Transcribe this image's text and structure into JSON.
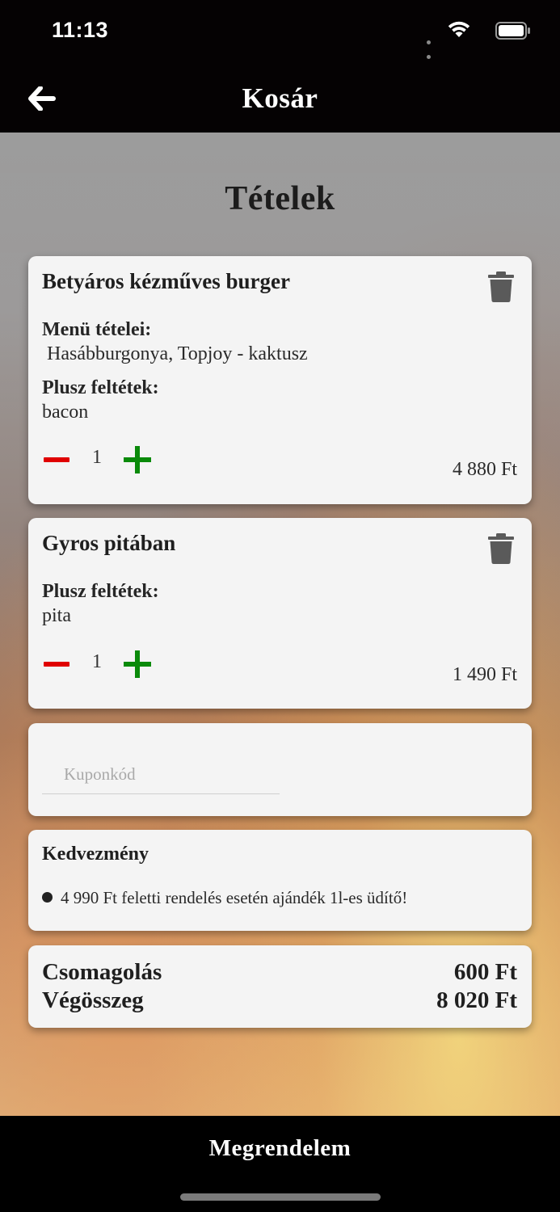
{
  "status_bar": {
    "time": "11:13"
  },
  "nav": {
    "title": "Kosár",
    "back_icon": "arrow-left-icon"
  },
  "page": {
    "title": "Tételek"
  },
  "cart_items": [
    {
      "name": "Betyáros kézműves burger",
      "menu_label": "Menü tételei:",
      "menu_value": "Hasábburgonya, Topjoy - kaktusz",
      "extras_label": "Plusz feltétek:",
      "extras_value": "bacon",
      "quantity": "1",
      "price": "4 880 Ft"
    },
    {
      "name": "Gyros pitában",
      "extras_label": "Plusz feltétek:",
      "extras_value": "pita",
      "quantity": "1",
      "price": "1 490 Ft"
    }
  ],
  "coupon": {
    "placeholder": "Kuponkód",
    "value": ""
  },
  "discount": {
    "title": "Kedvezmény",
    "items": [
      "4 990 Ft feletti rendelés esetén ajándék 1l-es üdítő!"
    ]
  },
  "summary": {
    "packaging_label": "Csomagolás",
    "packaging_value": "600 Ft",
    "total_label": "Végösszeg",
    "total_value": "8 020 Ft"
  },
  "actions": {
    "order_label": "Megrendelem"
  },
  "colors": {
    "minus": "#e00000",
    "plus": "#0a8a0a",
    "bar_background": "#050203",
    "card_background": "#f4f4f4"
  }
}
